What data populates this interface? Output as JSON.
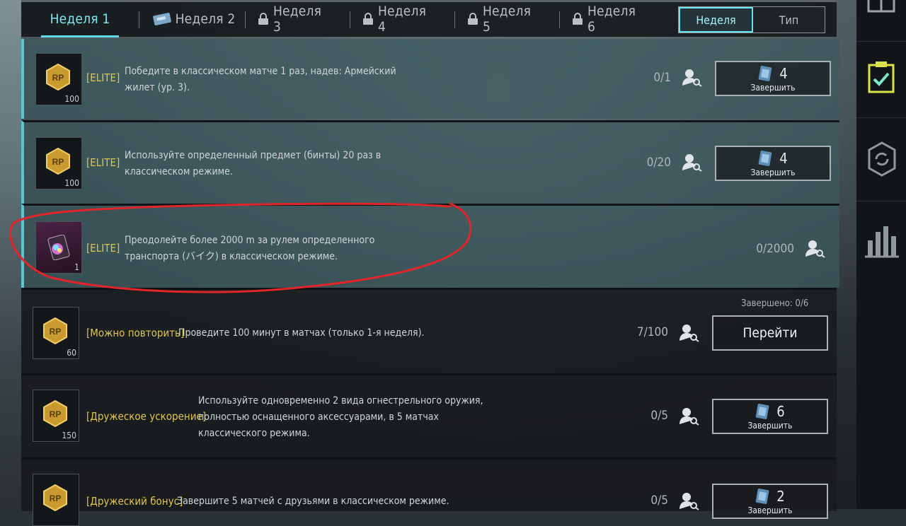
{
  "tabs": [
    {
      "label": "Неделя 1",
      "icon": "none",
      "state": "active"
    },
    {
      "label": "Неделя 2",
      "icon": "ticket-icon",
      "state": "normal"
    },
    {
      "label": "Неделя 3",
      "icon": "lock-icon",
      "state": "locked"
    },
    {
      "label": "Неделя 4",
      "icon": "lock-icon",
      "state": "locked"
    },
    {
      "label": "Неделя 5",
      "icon": "lock-icon",
      "state": "locked"
    },
    {
      "label": "Неделя 6",
      "icon": "lock-icon",
      "state": "locked"
    }
  ],
  "view_toggle": {
    "week": "Неделя",
    "type": "Тип",
    "selected": "Неделя"
  },
  "missions": [
    {
      "tag": "[ELITE]",
      "desc": "Победите в классическом матче 1 раз, надев: Армейский жилет (ур. 3).",
      "progress": "0/1",
      "reward_qty": "100",
      "reward_icon": "rp-coin-icon",
      "button": {
        "count": "4",
        "label": "Завершить"
      }
    },
    {
      "tag": "[ELITE]",
      "desc": "Используйте определенный предмет (бинты) 20 раз в классическом режиме.",
      "progress": "0/20",
      "reward_qty": "100",
      "reward_icon": "rp-coin-icon",
      "button": {
        "count": "4",
        "label": "Завершить"
      }
    },
    {
      "tag": "[ELITE]",
      "desc": "Преодолейте более 2000 m за рулем определенного транспорта (バイク) в классическом режиме.",
      "progress": "0/2000",
      "reward_qty": "1",
      "reward_icon": "color-card-icon",
      "button": null
    },
    {
      "tag": "[Можно повторить]",
      "desc": "Проведите 100 минут в матчах (только 1-я неделя).",
      "progress": "7/100",
      "reward_qty": "60",
      "reward_icon": "rp-coin-icon",
      "completed_note": "Завершено: 0/6",
      "button": {
        "label": "Перейти"
      }
    },
    {
      "tag": "[Дружеское ускорение]",
      "desc": "Используйте одновременно 2 вида огнестрельного оружия, полностью оснащенного аксессуарами, в 5 матчах классического режима.",
      "progress": "0/5",
      "reward_qty": "150",
      "reward_icon": "rp-coin-icon",
      "button": {
        "count": "6",
        "label": "Завершить"
      }
    },
    {
      "tag": "[Дружеский бонус]",
      "desc": "Завершите 5 матчей с друзьями в классическом режиме.",
      "progress": "0/5",
      "reward_qty": "",
      "reward_icon": "rp-coin-icon",
      "button": {
        "count": "2",
        "label": "Завершить"
      }
    }
  ],
  "sidebar": [
    "gift-icon",
    "missions-icon",
    "rp-badge-icon",
    "stats-icon"
  ],
  "colors": {
    "accent": "#62d8e6",
    "elite_tag": "#e0c64a",
    "annotation": "#e0262a"
  }
}
